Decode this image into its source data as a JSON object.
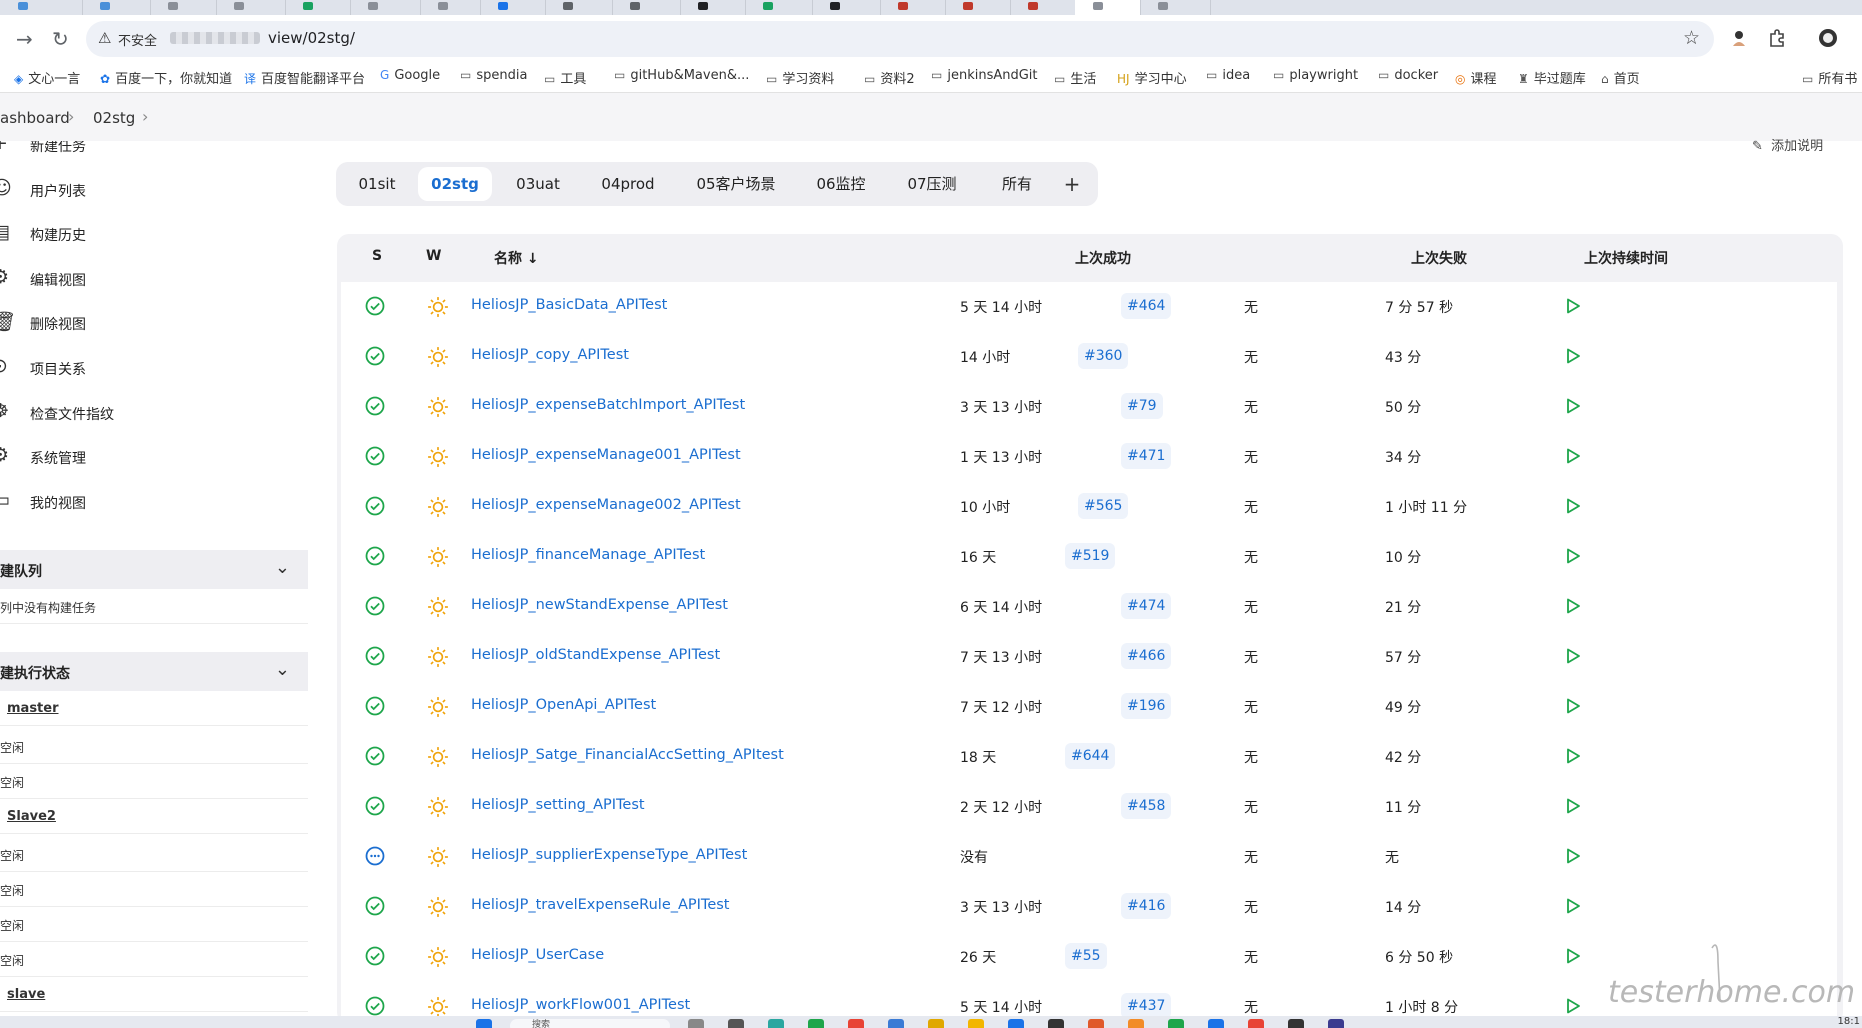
{
  "browser": {
    "tab_favicon_colors": [
      "#4a90d9",
      "#4a90d9",
      "#8a8f98",
      "#8a8f98",
      "#1aa260",
      "#8a8f98",
      "#8a8f98",
      "#1a73e8",
      "#5f6368",
      "#5f6368",
      "#202124",
      "#1aa260",
      "#202124",
      "#c0392b",
      "#c0392b",
      "#c0392b",
      "#8a8f98",
      "#8a8f98"
    ],
    "security_label": "不安全",
    "url_path": "view/02stg/",
    "bookmarks": [
      {
        "icon": "cube-icon",
        "label": "文心一言"
      },
      {
        "icon": "paw-icon",
        "label": "百度一下，你就知道"
      },
      {
        "icon": "translate-icon",
        "label": "百度智能翻译平台"
      },
      {
        "icon": "google-icon",
        "label": "Google"
      },
      {
        "icon": "folder-icon",
        "label": "spendia"
      },
      {
        "icon": "folder-icon",
        "label": "工具"
      },
      {
        "icon": "folder-icon",
        "label": "gitHub&Maven&..."
      },
      {
        "icon": "folder-icon",
        "label": "学习资料"
      },
      {
        "icon": "folder-icon",
        "label": "资料2"
      },
      {
        "icon": "folder-icon",
        "label": "jenkinsAndGit"
      },
      {
        "icon": "folder-icon",
        "label": "生活"
      },
      {
        "icon": "hj-icon",
        "label": "学习中心"
      },
      {
        "icon": "folder-icon",
        "label": "idea"
      },
      {
        "icon": "folder-icon",
        "label": "playwright"
      },
      {
        "icon": "folder-icon",
        "label": "docker"
      },
      {
        "icon": "course-icon",
        "label": "课程"
      },
      {
        "icon": "quiz-icon",
        "label": "毕过题库"
      },
      {
        "icon": "home-icon",
        "label": "首页"
      },
      {
        "icon": "folder-icon",
        "label": "所有书"
      }
    ]
  },
  "breadcrumb": {
    "items": [
      "ashboard",
      "02stg"
    ]
  },
  "sidebar": {
    "items": [
      {
        "icon": "plus-icon",
        "label": "新建任务"
      },
      {
        "icon": "users-icon",
        "label": "用户列表"
      },
      {
        "icon": "history-icon",
        "label": "构建历史"
      },
      {
        "icon": "gear-icon",
        "label": "编辑视图"
      },
      {
        "icon": "trash-icon",
        "label": "删除视图"
      },
      {
        "icon": "relation-icon",
        "label": "项目关系"
      },
      {
        "icon": "fingerprint-icon",
        "label": "检查文件指纹"
      },
      {
        "icon": "gear-icon",
        "label": "系统管理"
      },
      {
        "icon": "window-icon",
        "label": "我的视图"
      }
    ],
    "queue": {
      "title": "建队列",
      "empty_text": "列中没有构建任务"
    },
    "executors": {
      "title": "建执行状态",
      "lines": [
        {
          "kind": "node",
          "text": "master"
        },
        {
          "kind": "idle",
          "text": "空闲"
        },
        {
          "kind": "idle",
          "text": "空闲"
        },
        {
          "kind": "node",
          "text": "Slave2"
        },
        {
          "kind": "idle",
          "text": "空闲"
        },
        {
          "kind": "idle",
          "text": "空闲"
        },
        {
          "kind": "idle",
          "text": "空闲"
        },
        {
          "kind": "idle",
          "text": "空闲"
        },
        {
          "kind": "node",
          "text": "slave"
        }
      ]
    }
  },
  "edit_description": "添加说明",
  "view_tabs": {
    "tabs": [
      "01sit",
      "02stg",
      "03uat",
      "04prod",
      "05客户场景",
      "06监控",
      "07压测",
      "所有"
    ],
    "active": "02stg",
    "add_label": "+"
  },
  "table": {
    "headers": {
      "s": "S",
      "w": "W",
      "name": "名称 ↓",
      "last_success": "上次成功",
      "last_failure": "上次失败",
      "last_duration": "上次持续时间"
    },
    "rows": [
      {
        "status": "success",
        "name": "HeliosJP_BasicData_APITest",
        "last_success": "5 天 14 小时",
        "build": "#464",
        "last_failure": "无",
        "duration": "7 分 57 秒"
      },
      {
        "status": "success",
        "name": "HeliosJP_copy_APITest",
        "last_success": "14 小时",
        "build": "#360",
        "last_failure": "无",
        "duration": "43 分"
      },
      {
        "status": "success",
        "name": "HeliosJP_expenseBatchImport_APITest",
        "last_success": "3 天 13 小时",
        "build": "#79",
        "last_failure": "无",
        "duration": "50 分"
      },
      {
        "status": "success",
        "name": "HeliosJP_expenseManage001_APITest",
        "last_success": "1 天 13 小时",
        "build": "#471",
        "last_failure": "无",
        "duration": "34 分"
      },
      {
        "status": "success",
        "name": "HeliosJP_expenseManage002_APITest",
        "last_success": "10 小时",
        "build": "#565",
        "last_failure": "无",
        "duration": "1 小时 11 分"
      },
      {
        "status": "success",
        "name": "HeliosJP_financeManage_APITest",
        "last_success": "16 天",
        "build": "#519",
        "last_failure": "无",
        "duration": "10 分"
      },
      {
        "status": "success",
        "name": "HeliosJP_newStandExpense_APITest",
        "last_success": "6 天 14 小时",
        "build": "#474",
        "last_failure": "无",
        "duration": "21 分"
      },
      {
        "status": "success",
        "name": "HeliosJP_oldStandExpense_APITest",
        "last_success": "7 天 13 小时",
        "build": "#466",
        "last_failure": "无",
        "duration": "57 分"
      },
      {
        "status": "success",
        "name": "HeliosJP_OpenApi_APITest",
        "last_success": "7 天 12 小时",
        "build": "#196",
        "last_failure": "无",
        "duration": "49 分"
      },
      {
        "status": "success",
        "name": "HeliosJP_Satge_FinancialAccSetting_APItest",
        "last_success": "18 天",
        "build": "#644",
        "last_failure": "无",
        "duration": "42 分"
      },
      {
        "status": "success",
        "name": "HeliosJP_setting_APITest",
        "last_success": "2 天 12 小时",
        "build": "#458",
        "last_failure": "无",
        "duration": "11 分"
      },
      {
        "status": "notbuilt",
        "name": "HeliosJP_supplierExpenseType_APITest",
        "last_success": "没有",
        "build": "",
        "last_failure": "无",
        "duration": "无"
      },
      {
        "status": "success",
        "name": "HeliosJP_travelExpenseRule_APITest",
        "last_success": "3 天 13 小时",
        "build": "#416",
        "last_failure": "无",
        "duration": "14 分"
      },
      {
        "status": "success",
        "name": "HeliosJP_UserCase",
        "last_success": "26 天",
        "build": "#55",
        "last_failure": "无",
        "duration": "6 分 50 秒"
      },
      {
        "status": "success",
        "name": "HeliosJP_workFlow001_APITest",
        "last_success": "5 天 14 小时",
        "build": "#437",
        "last_failure": "无",
        "duration": "1 小时 8 分"
      }
    ]
  },
  "colors": {
    "success": "#1ea64b",
    "link": "#1b6ed0",
    "weather": "#f0a30a",
    "notbuilt": "#1b6ed0",
    "play": "#1ea64b"
  },
  "taskbar": {
    "search_placeholder": "搜索",
    "icon_colors": [
      "#1a73e8",
      "#888888",
      "#555555",
      "#2aa7a0",
      "#1ea64b",
      "#e84335",
      "#3a7bd5",
      "#e0a800",
      "#f2b600",
      "#1a73e8",
      "#333333",
      "#e05a2b",
      "#f28c28",
      "#1ea64b",
      "#1a73e8",
      "#e84335",
      "#333333",
      "#3b3b8f"
    ],
    "clock": "18:1"
  },
  "watermark": "testerhome.com"
}
